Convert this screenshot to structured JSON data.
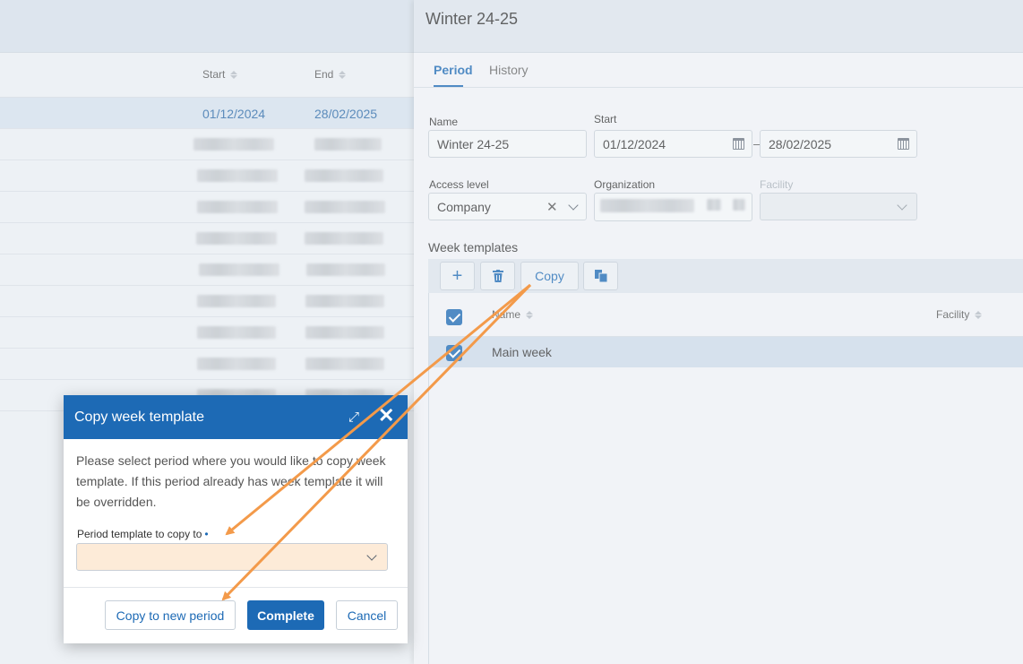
{
  "list": {
    "col_start": "Start",
    "col_end": "End",
    "selected_row": {
      "start": "01/12/2024",
      "end": "28/02/2025"
    }
  },
  "panel": {
    "title": "Winter 24-25",
    "tabs": [
      "Period",
      "History"
    ],
    "name_label": "Name",
    "name_value": "Winter 24-25",
    "start_label": "Start",
    "start_value": "01/12/2024",
    "range_separator": "–",
    "end_value": "28/02/2025",
    "access_label": "Access level",
    "access_value": "Company",
    "org_label": "Organization",
    "facility_label": "Facility",
    "week_templates_label": "Week templates",
    "copy_label": "Copy",
    "grid_col_name": "Name",
    "grid_col_facility": "Facility",
    "grid_row_name": "Main week"
  },
  "dialog": {
    "title": "Copy week template",
    "body": "Please select period where you would like to copy week template. If this period already has week template it will be overridden.",
    "field_label": "Period template to copy to",
    "required_mark": "•",
    "btn_copy_new": "Copy to new period",
    "btn_complete": "Complete",
    "btn_cancel": "Cancel"
  },
  "colors": {
    "accent": "#1d6ab5",
    "annotation_arrow": "#f39a4a",
    "highlight_field": "#fdebd8"
  },
  "icons": [
    "sort-icon",
    "calendar-icon",
    "clear-icon",
    "chevron-down-icon",
    "plus-icon",
    "trash-icon",
    "duplicate-icon",
    "expand-icon",
    "close-icon",
    "checkbox-checked-icon"
  ]
}
